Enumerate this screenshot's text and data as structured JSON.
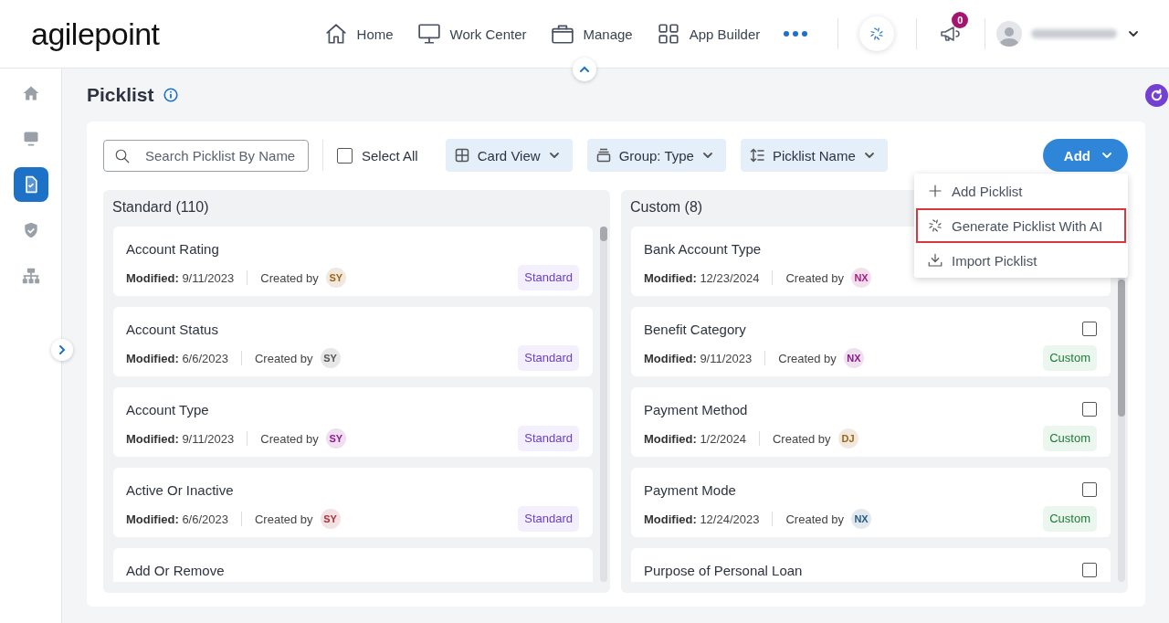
{
  "header": {
    "logo": "agilepoint",
    "nav": [
      {
        "label": "Home"
      },
      {
        "label": "Work Center"
      },
      {
        "label": "Manage"
      },
      {
        "label": "App Builder"
      }
    ],
    "notification_count": "0"
  },
  "sidebar": {
    "items": [
      {
        "selected": false
      },
      {
        "selected": false
      },
      {
        "selected": true
      },
      {
        "selected": false
      },
      {
        "selected": false
      }
    ]
  },
  "page": {
    "title": "Picklist"
  },
  "toolbar": {
    "search": {
      "placeholder": "Search Picklist By Name"
    },
    "select_all": {
      "label": "Select All",
      "checked": false
    },
    "view": "Card View",
    "group": "Group: Type",
    "sort": "Picklist Name",
    "add": "Add"
  },
  "add_menu": [
    {
      "label": "Add Picklist",
      "highlighted": false
    },
    {
      "label": "Generate Picklist With AI",
      "highlighted": true
    },
    {
      "label": "Import Picklist",
      "highlighted": false
    }
  ],
  "groups": [
    {
      "title": "Standard (110)",
      "kind": "standard",
      "cards": [
        {
          "name": "Account Rating",
          "modified_label": "Modified:",
          "modified": "9/11/2023",
          "created_by_label": "Created by",
          "initials": "SY",
          "color": "#9a6518",
          "tag": "Standard"
        },
        {
          "name": "Account Status",
          "modified_label": "Modified:",
          "modified": "6/6/2023",
          "created_by_label": "Created by",
          "initials": "SY",
          "color": "#555555",
          "tag": "Standard"
        },
        {
          "name": "Account Type",
          "modified_label": "Modified:",
          "modified": "9/11/2023",
          "created_by_label": "Created by",
          "initials": "SY",
          "color": "#8e1a8e",
          "tag": "Standard"
        },
        {
          "name": "Active Or Inactive",
          "modified_label": "Modified:",
          "modified": "6/6/2023",
          "created_by_label": "Created by",
          "initials": "SY",
          "color": "#a8333a",
          "tag": "Standard"
        },
        {
          "name": "Add Or Remove"
        }
      ]
    },
    {
      "title": "Custom (8)",
      "kind": "custom",
      "cards": [
        {
          "name": "Bank Account Type",
          "modified_label": "Modified:",
          "modified": "12/23/2024",
          "created_by_label": "Created by",
          "initials": "NX",
          "color": "#a8207e"
        },
        {
          "name": "Benefit Category",
          "modified_label": "Modified:",
          "modified": "9/11/2023",
          "created_by_label": "Created by",
          "initials": "NX",
          "color": "#8a1a8a",
          "tag": "Custom",
          "checked": false
        },
        {
          "name": "Payment Method",
          "modified_label": "Modified:",
          "modified": "1/2/2024",
          "created_by_label": "Created by",
          "initials": "DJ",
          "color": "#9a6518",
          "tag": "Custom",
          "checked": false
        },
        {
          "name": "Payment Mode",
          "modified_label": "Modified:",
          "modified": "12/24/2023",
          "created_by_label": "Created by",
          "initials": "NX",
          "color": "#2a5b83",
          "tag": "Custom",
          "checked": false
        },
        {
          "name": "Purpose of Personal Loan",
          "checked": false
        }
      ]
    }
  ]
}
